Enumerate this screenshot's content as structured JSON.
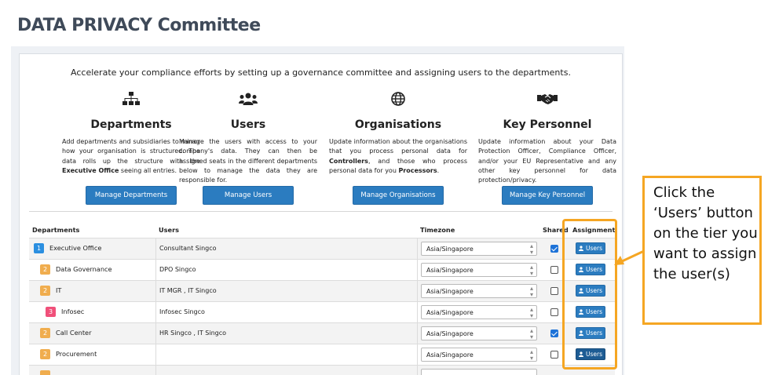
{
  "page": {
    "title": "DATA PRIVACY Committee"
  },
  "intro": "Accelerate your compliance efforts by setting up a governance committee and assigning users to the departments.",
  "features": [
    {
      "icon": "sitemap-icon",
      "heading": "Departments",
      "desc_parts": [
        "Add departments and subsidiaries to mirror how your organisation is structured. The data rolls up the structure with the ",
        "Executive Office",
        " seeing all entries.",
        "",
        ""
      ],
      "button": "Manage Departments"
    },
    {
      "icon": "users-group-icon",
      "heading": "Users",
      "desc_parts": [
        "Manage the users with access to your company's data. They can then be assigned seats in the different departments below to manage the data they are responsible for.",
        "",
        "",
        "",
        ""
      ],
      "button": "Manage Users"
    },
    {
      "icon": "globe-icon",
      "heading": "Organisations",
      "desc_parts": [
        "Update information about the organisations that you process personal data for ",
        "Controllers",
        ", and those who process personal data for you ",
        "Processors",
        "."
      ],
      "button": "Manage Organisations"
    },
    {
      "icon": "handshake-icon",
      "heading": "Key Personnel",
      "desc_parts": [
        "Update information about your Data Protection Officer, Compliance Officer, and/or your EU Representative and any other key personnel for data protection/privacy.",
        "",
        "",
        "",
        ""
      ],
      "button": "Manage Key Personnel"
    }
  ],
  "table": {
    "headers": {
      "departments": "Departments",
      "users": "Users",
      "timezone": "Timezone",
      "shared": "Shared",
      "assignment": "Assignment"
    },
    "rows": [
      {
        "tier": "1",
        "tier_color": "#2b8fe0",
        "department": "Executive Office",
        "users": "Consultant Singco",
        "timezone": "Asia/Singapore",
        "shared": true,
        "button": "Users"
      },
      {
        "tier": "2",
        "tier_color": "#f0ad4e",
        "department": "Data Governance",
        "users": "DPO Singco",
        "timezone": "Asia/Singapore",
        "shared": false,
        "button": "Users"
      },
      {
        "tier": "2",
        "tier_color": "#f0ad4e",
        "department": "IT",
        "users": "IT MGR , IT Singco",
        "timezone": "Asia/Singapore",
        "shared": false,
        "button": "Users"
      },
      {
        "tier": "3",
        "tier_color": "#f0507a",
        "department": "Infosec",
        "users": "Infosec Singco",
        "timezone": "Asia/Singapore",
        "shared": false,
        "button": "Users"
      },
      {
        "tier": "2",
        "tier_color": "#f0ad4e",
        "department": "Call Center",
        "users": "HR Singco , IT Singco",
        "timezone": "Asia/Singapore",
        "shared": true,
        "button": "Users"
      },
      {
        "tier": "2",
        "tier_color": "#f0ad4e",
        "department": "Procurement",
        "users": "",
        "timezone": "Asia/Singapore",
        "shared": false,
        "button": "Users"
      }
    ]
  },
  "callout": {
    "text": "Click the ‘Users’ button on the tier you want to assign the user(s)"
  },
  "colors": {
    "primary_button": "#2b7cc0",
    "highlight": "#f5a623"
  }
}
